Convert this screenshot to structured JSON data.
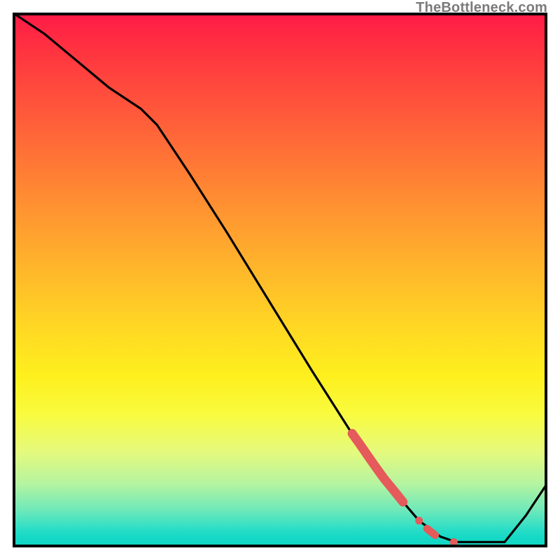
{
  "watermark": "TheBottleneck.com",
  "chart_data": {
    "type": "line",
    "title": "",
    "xlabel": "",
    "ylabel": "",
    "xlim": [
      0,
      100
    ],
    "ylim": [
      0,
      100
    ],
    "grid": false,
    "legend": false,
    "series": [
      {
        "name": "curve",
        "color": "#000000",
        "x": [
          0,
          6,
          12,
          18,
          24,
          27,
          33,
          40,
          48,
          56,
          63,
          70,
          76,
          80,
          83,
          87,
          92,
          96,
          100
        ],
        "y": [
          100,
          96,
          91,
          86,
          82,
          79,
          70,
          59,
          46,
          33,
          22,
          12,
          5,
          2,
          1,
          1,
          1,
          6,
          12
        ]
      },
      {
        "name": "highlight-points",
        "color": "#e55a5a",
        "type": "scatter",
        "x": [
          63.5,
          65,
          66.5,
          68,
          69.5,
          71,
          73,
          76,
          77.5,
          79,
          82.5
        ],
        "y": [
          21.3,
          19.2,
          17.0,
          14.9,
          12.8,
          11.0,
          8.5,
          5.0,
          3.5,
          2.3,
          1.0
        ]
      }
    ]
  },
  "colors": {
    "gradient_top": "#ff1a47",
    "gradient_bottom": "#0fd6c3",
    "line": "#000000",
    "marker": "#e55a5a",
    "frame": "#000000",
    "watermark": "#7a7a7a"
  }
}
